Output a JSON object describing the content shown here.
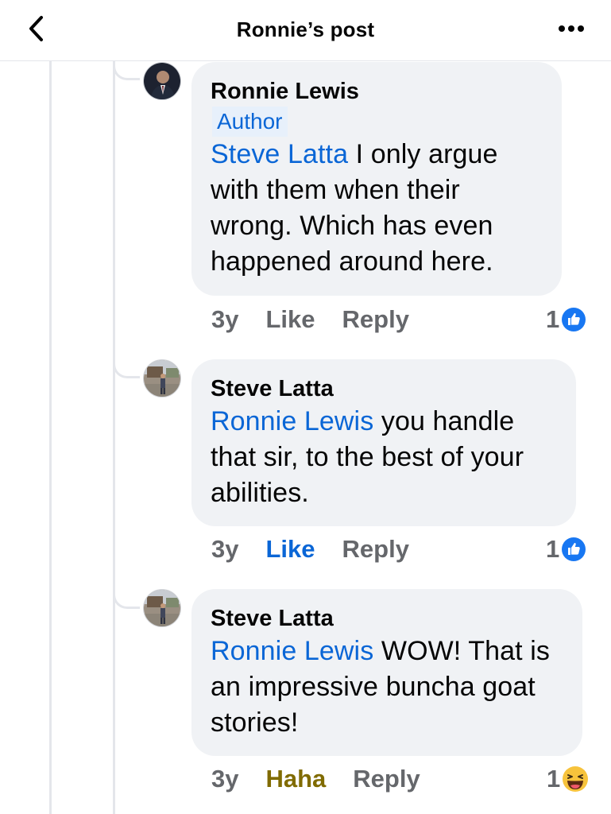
{
  "header": {
    "title": "Ronnie’s post",
    "back_icon": "chevron-left-icon",
    "more_icon": "more-horizontal-icon"
  },
  "colors": {
    "mention": "#0a66d6",
    "bubble": "#f0f2f5",
    "meta": "#65676b",
    "haha": "#806b00"
  },
  "comments": [
    {
      "author": "Ronnie Lewis",
      "badge": "Author",
      "mention": "Steve Latta",
      "text": " I only argue with them when their wrong. Which has even happened around here.",
      "time": "3y",
      "like_label": "Like",
      "reply_label": "Reply",
      "reaction_count": "1",
      "reaction_icon": "like-reaction-icon"
    },
    {
      "author": "Steve Latta",
      "mention": "Ronnie Lewis",
      "text": " you handle that sir, to the best of your abilities.",
      "time": "3y",
      "like_label": "Like",
      "reply_label": "Reply",
      "reaction_count": "1",
      "reaction_icon": "like-reaction-icon"
    },
    {
      "author": "Steve Latta",
      "mention": "Ronnie Lewis",
      "text": " WOW! That is an impressive buncha goat stories!",
      "time": "3y",
      "like_label": "Haha",
      "reply_label": "Reply",
      "reaction_count": "1",
      "reaction_icon": "haha-reaction-icon"
    }
  ]
}
